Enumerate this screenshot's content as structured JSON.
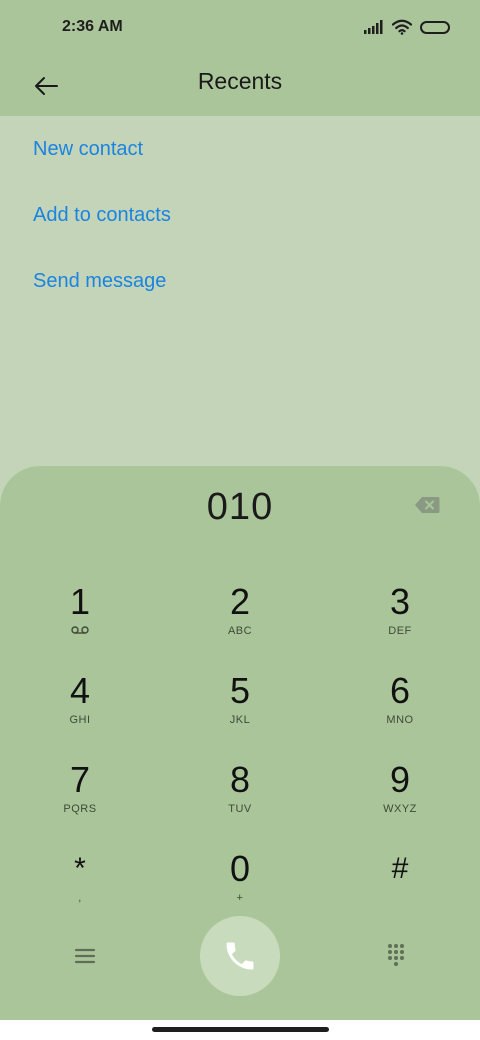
{
  "status_bar": {
    "time": "2:36 AM"
  },
  "header": {
    "title": "Recents"
  },
  "actions": [
    {
      "label": "New contact"
    },
    {
      "label": "Add to contacts"
    },
    {
      "label": "Send message"
    }
  ],
  "dialer": {
    "number": "010",
    "keys": [
      {
        "digit": "1",
        "letters": "",
        "sub_icon": "voicemail-icon"
      },
      {
        "digit": "2",
        "letters": "ABC"
      },
      {
        "digit": "3",
        "letters": "DEF"
      },
      {
        "digit": "4",
        "letters": "GHI"
      },
      {
        "digit": "5",
        "letters": "JKL"
      },
      {
        "digit": "6",
        "letters": "MNO"
      },
      {
        "digit": "7",
        "letters": "PQRS"
      },
      {
        "digit": "8",
        "letters": "TUV"
      },
      {
        "digit": "9",
        "letters": "WXYZ"
      },
      {
        "digit": "*",
        "letters": ","
      },
      {
        "digit": "0",
        "letters": "+"
      },
      {
        "digit": "#",
        "letters": ""
      }
    ]
  },
  "icons": {
    "back": "arrow-left-icon",
    "backspace": "backspace-icon",
    "menu": "menu-icon",
    "call": "phone-icon",
    "keypad": "dialpad-icon",
    "signal": "signal-icon",
    "wifi": "wifi-icon",
    "battery": "battery-icon"
  },
  "colors": {
    "accent_link": "#1a84e0",
    "header_bg": "#abc59a",
    "content_bg": "#c4d4b8",
    "call_button": "#c8dbbc"
  }
}
